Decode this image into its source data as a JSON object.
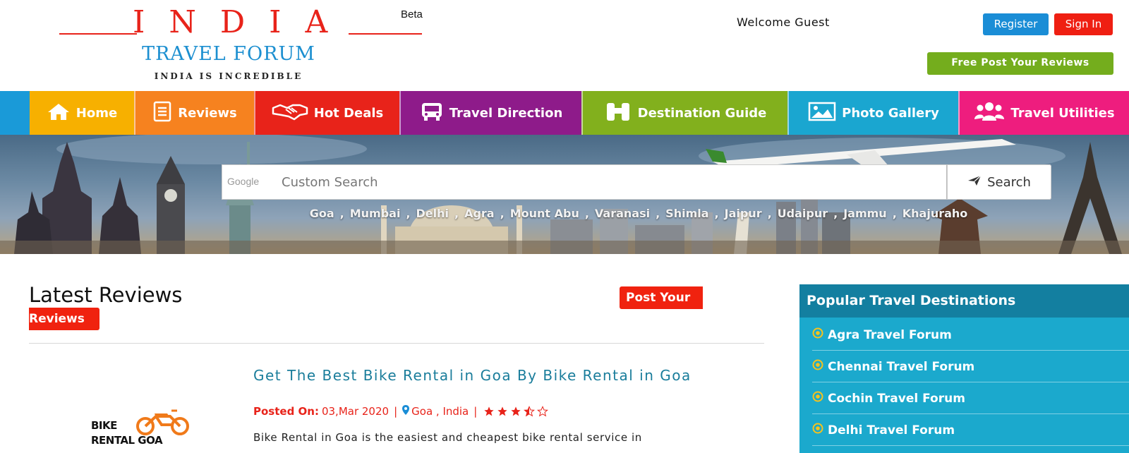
{
  "header": {
    "logo": {
      "india": "INDIA",
      "beta": "Beta",
      "forum": "TRAVEL FORUM",
      "tagline": "INDIA IS INCREDIBLE"
    },
    "welcome": "Welcome  Guest",
    "register_label": "Register",
    "signin_label": "Sign In",
    "free_post_label": "Free Post Your Reviews"
  },
  "nav": {
    "items": [
      {
        "label": "Home",
        "icon": "home-icon",
        "color": "#f7b000"
      },
      {
        "label": "Reviews",
        "icon": "document-icon",
        "color": "#f6821f"
      },
      {
        "label": "Hot Deals",
        "icon": "handshake-icon",
        "color": "#e8231a"
      },
      {
        "label": "Travel Direction",
        "icon": "bus-icon",
        "color": "#8e1b8a"
      },
      {
        "label": "Destination Guide",
        "icon": "binoculars-icon",
        "color": "#82b01d"
      },
      {
        "label": "Photo Gallery",
        "icon": "photo-icon",
        "color": "#1aa6d0"
      },
      {
        "label": "Travel Utilities",
        "icon": "users-icon",
        "color": "#ee1d7e"
      }
    ]
  },
  "search": {
    "brand": "Google",
    "placeholder": "Custom Search",
    "button_label": "Search",
    "button_icon": "paper-plane-icon",
    "cities": [
      "Goa",
      "Mumbai",
      "Delhi",
      "Agra",
      "Mount Abu",
      "Varanasi",
      "Shimla",
      "Jaipur",
      "Udaipur",
      "Jammu",
      "Khajuraho"
    ],
    "city_separator": ","
  },
  "main": {
    "title": "Latest Reviews",
    "post_button_part1": "Post Your",
    "post_button_part2": "Reviews",
    "review": {
      "title": "Get The Best Bike Rental in Goa By Bike Rental in Goa",
      "posted_label": "Posted On:",
      "date": "03,Mar 2020",
      "location": "Goa , India",
      "separator": "|",
      "rating": 3.5,
      "rating_max": 5,
      "text": "Bike Rental in Goa is the easiest and cheapest bike rental service in",
      "logo_line1": "BIKE",
      "logo_line2": "RENTAL GOA"
    }
  },
  "sidebar": {
    "title": "Popular Travel Destinations",
    "items": [
      "Agra Travel Forum",
      "Chennai Travel Forum",
      "Cochin Travel Forum",
      "Delhi Travel Forum"
    ]
  },
  "colors": {
    "brand_red": "#e8231a",
    "brand_blue": "#1c8fd0",
    "green": "#74ad1d",
    "sidebar": "#1ba9cd",
    "sidebar_head": "#137fa0",
    "review_title": "#1a7d9b"
  }
}
